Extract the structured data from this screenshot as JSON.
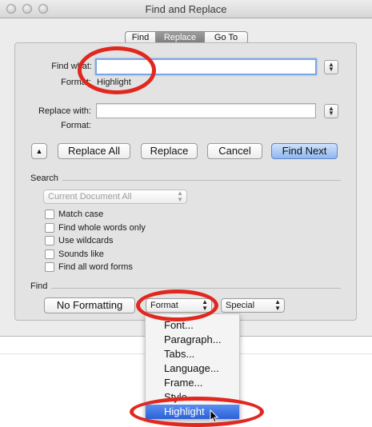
{
  "window": {
    "title": "Find and Replace"
  },
  "tabs": [
    {
      "label": "Find",
      "selected": false
    },
    {
      "label": "Replace",
      "selected": true
    },
    {
      "label": "Go To",
      "selected": false
    }
  ],
  "find": {
    "label": "Find what:",
    "value": "",
    "format_label": "Format:",
    "format_value": "Highlight"
  },
  "replace": {
    "label": "Replace with:",
    "value": "",
    "format_label": "Format:",
    "format_value": ""
  },
  "buttons": {
    "collapse": "▲",
    "replace_all": "Replace All",
    "replace": "Replace",
    "cancel": "Cancel",
    "find_next": "Find Next"
  },
  "search": {
    "section_label": "Search",
    "scope": "Current Document All",
    "options": [
      {
        "label": "Match case",
        "checked": false
      },
      {
        "label": "Find whole words only",
        "checked": false
      },
      {
        "label": "Use wildcards",
        "checked": false
      },
      {
        "label": "Sounds like",
        "checked": false
      },
      {
        "label": "Find all word forms",
        "checked": false
      }
    ]
  },
  "find_section": {
    "label": "Find",
    "no_formatting": "No Formatting",
    "format_popup": "Format",
    "special_popup": "Special"
  },
  "format_menu": {
    "items": [
      "Font...",
      "Paragraph...",
      "Tabs...",
      "Language...",
      "Frame...",
      "Style...",
      "Highlight"
    ],
    "highlighted": "Highlight"
  },
  "colors": {
    "annotation": "#e0281f",
    "accent": "#2a62d8"
  }
}
